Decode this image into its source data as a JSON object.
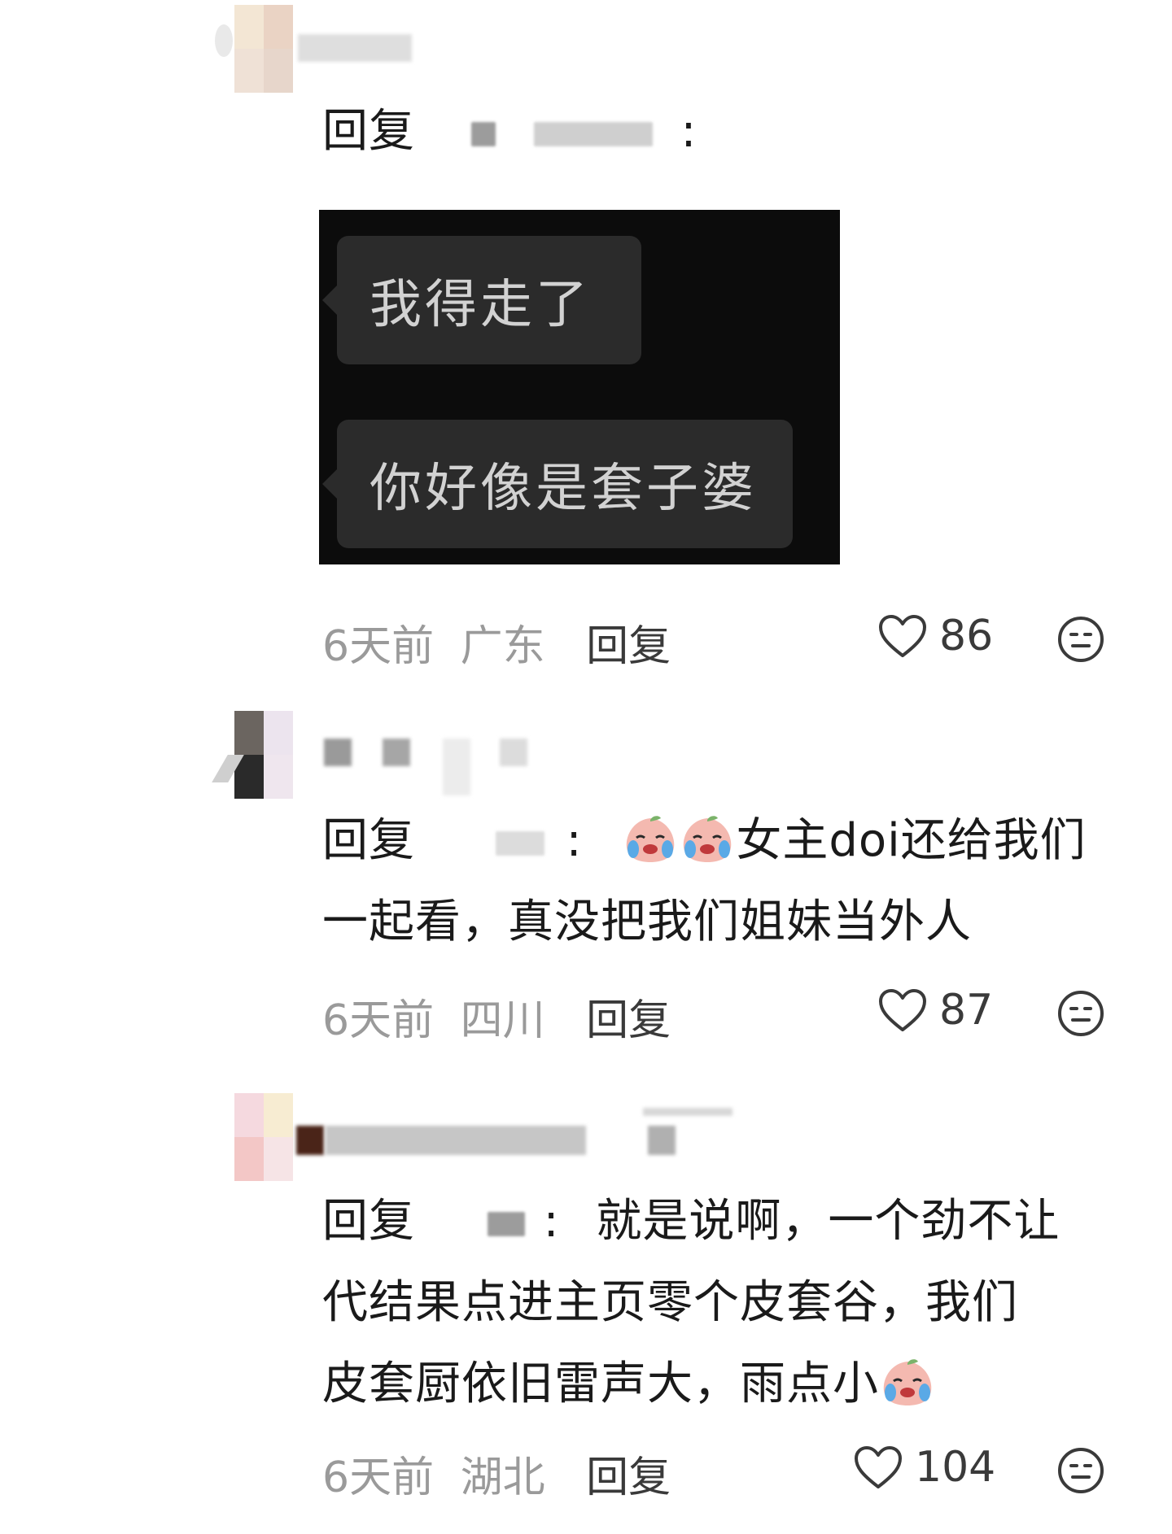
{
  "comments": [
    {
      "reply_prefix": "回复",
      "colon": ":",
      "chat_image": {
        "messages": [
          "我得走了",
          "你好像是套子婆"
        ]
      },
      "meta": {
        "time": "6天前",
        "location": "广东",
        "reply_label": "回复"
      },
      "likes": "86"
    },
    {
      "reply_prefix": "回复",
      "colon": ":",
      "text_line1": "女主doi还给我们",
      "text_line2": "一起看，真没把我们姐妹当外人",
      "emoji_count": 2,
      "meta": {
        "time": "6天前",
        "location": "四川",
        "reply_label": "回复"
      },
      "likes": "87"
    },
    {
      "reply_prefix": "回复",
      "colon": ":",
      "text_line1": "就是说啊，一个劲不让",
      "text_line2": "代结果点进主页零个皮套谷，我们",
      "text_line3": "皮套厨依旧雷声大，雨点小",
      "emoji_count": 1,
      "meta": {
        "time": "6天前",
        "location": "湖北",
        "reply_label": "回复"
      },
      "likes": "104"
    }
  ],
  "icons": {
    "like": "heart-outline-icon",
    "dislike": "meh-face-icon",
    "emoji": "crying-peach-emoji"
  },
  "colors": {
    "meta_gray": "#9a9a9a",
    "chat_bg": "#0c0c0c",
    "bubble_bg": "#2b2b2b"
  }
}
